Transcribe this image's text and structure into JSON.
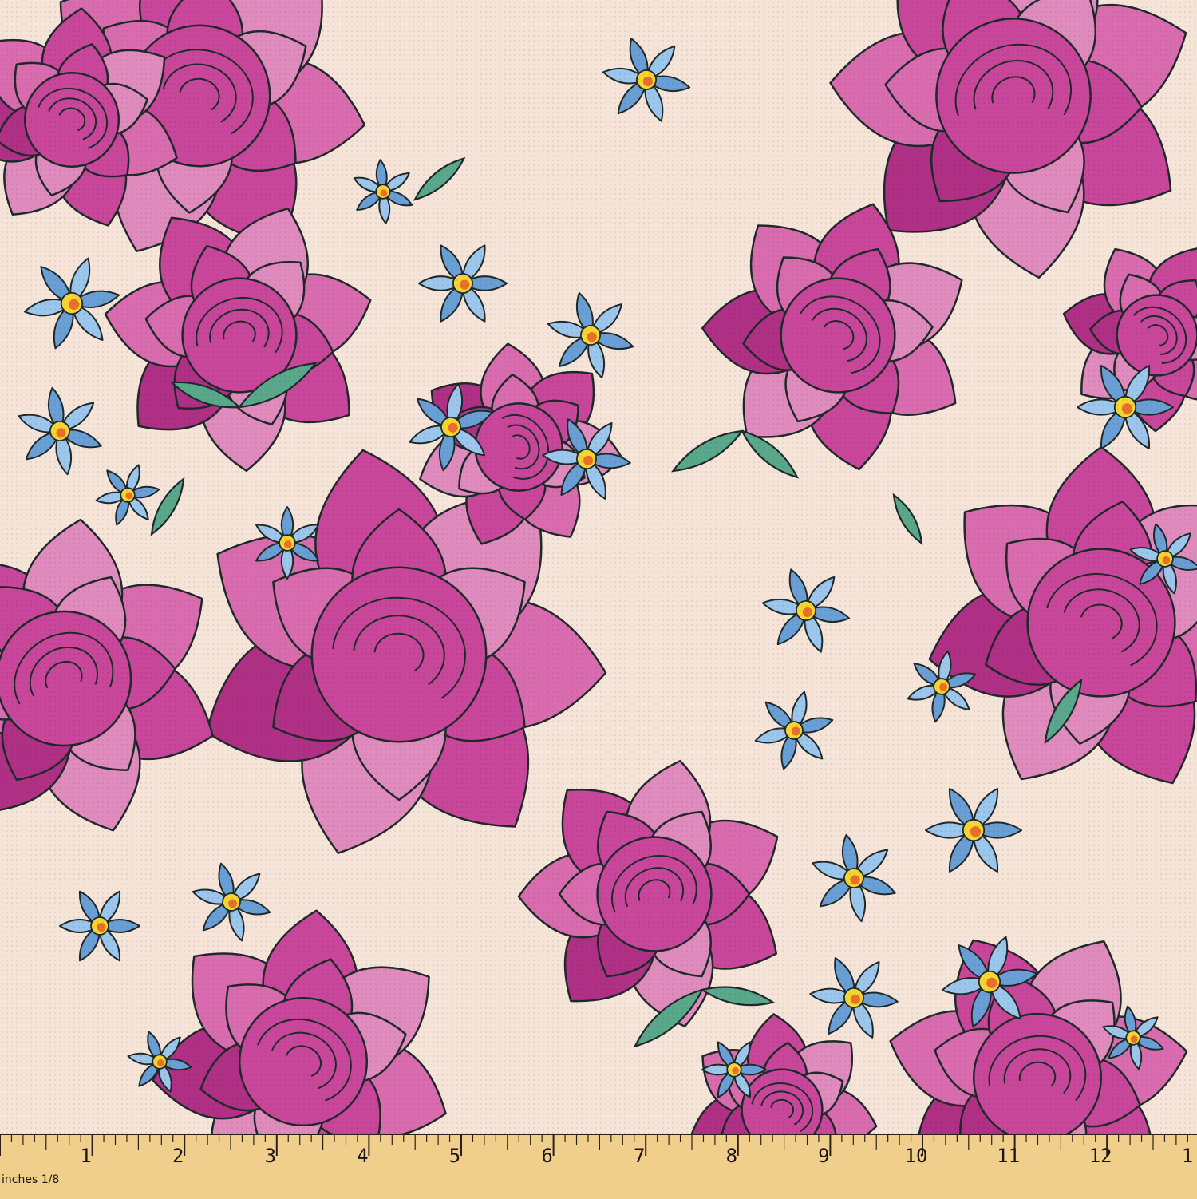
{
  "ruler": {
    "unit_label": "inches 1/8",
    "numbers": [
      "1",
      "2",
      "3",
      "4",
      "5",
      "6",
      "7",
      "8",
      "9",
      "10",
      "11",
      "12",
      "1"
    ]
  },
  "colors": {
    "background": "#f6e4d8",
    "rose_light": "#d96cae",
    "rose_mid": "#c9479b",
    "rose_dark": "#b03085",
    "rose_pale": "#e08bbd",
    "petal_blue": "#9cc6ec",
    "petal_blue_dark": "#6a9fd6",
    "leaf": "#5aa88c",
    "center_yellow": "#f6d431",
    "center_orange": "#e8702a",
    "outline": "#1e2a2a",
    "ruler": "#f0cf8c"
  },
  "icons": [
    "rose-icon",
    "blue-blossom-icon",
    "leaf-icon"
  ]
}
